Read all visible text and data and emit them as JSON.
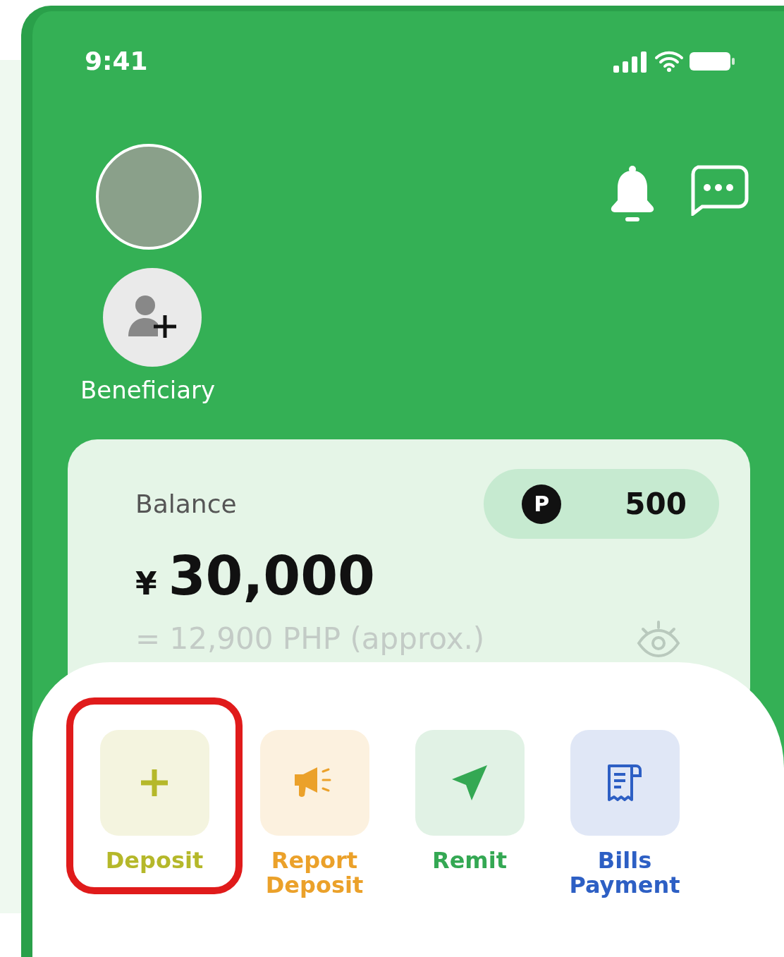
{
  "status_bar": {
    "time": "9:41"
  },
  "beneficiary": {
    "label": "Beneficiary"
  },
  "balance": {
    "label": "Balance",
    "points": "500",
    "points_badge": "P",
    "currency": "¥",
    "amount": "30,000",
    "converted": "= 12,900 PHP (approx.)"
  },
  "actions": [
    {
      "label": "Deposit",
      "kind": "plus",
      "color": "#b5b82a",
      "highlighted": true
    },
    {
      "label": "Report Deposit",
      "kind": "megaphone",
      "color": "#eba12a",
      "highlighted": false
    },
    {
      "label": "Remit",
      "kind": "send",
      "color": "#34a853",
      "highlighted": false
    },
    {
      "label": "Bills Payment",
      "kind": "receipt",
      "color": "#2d5fc4",
      "highlighted": false
    }
  ]
}
